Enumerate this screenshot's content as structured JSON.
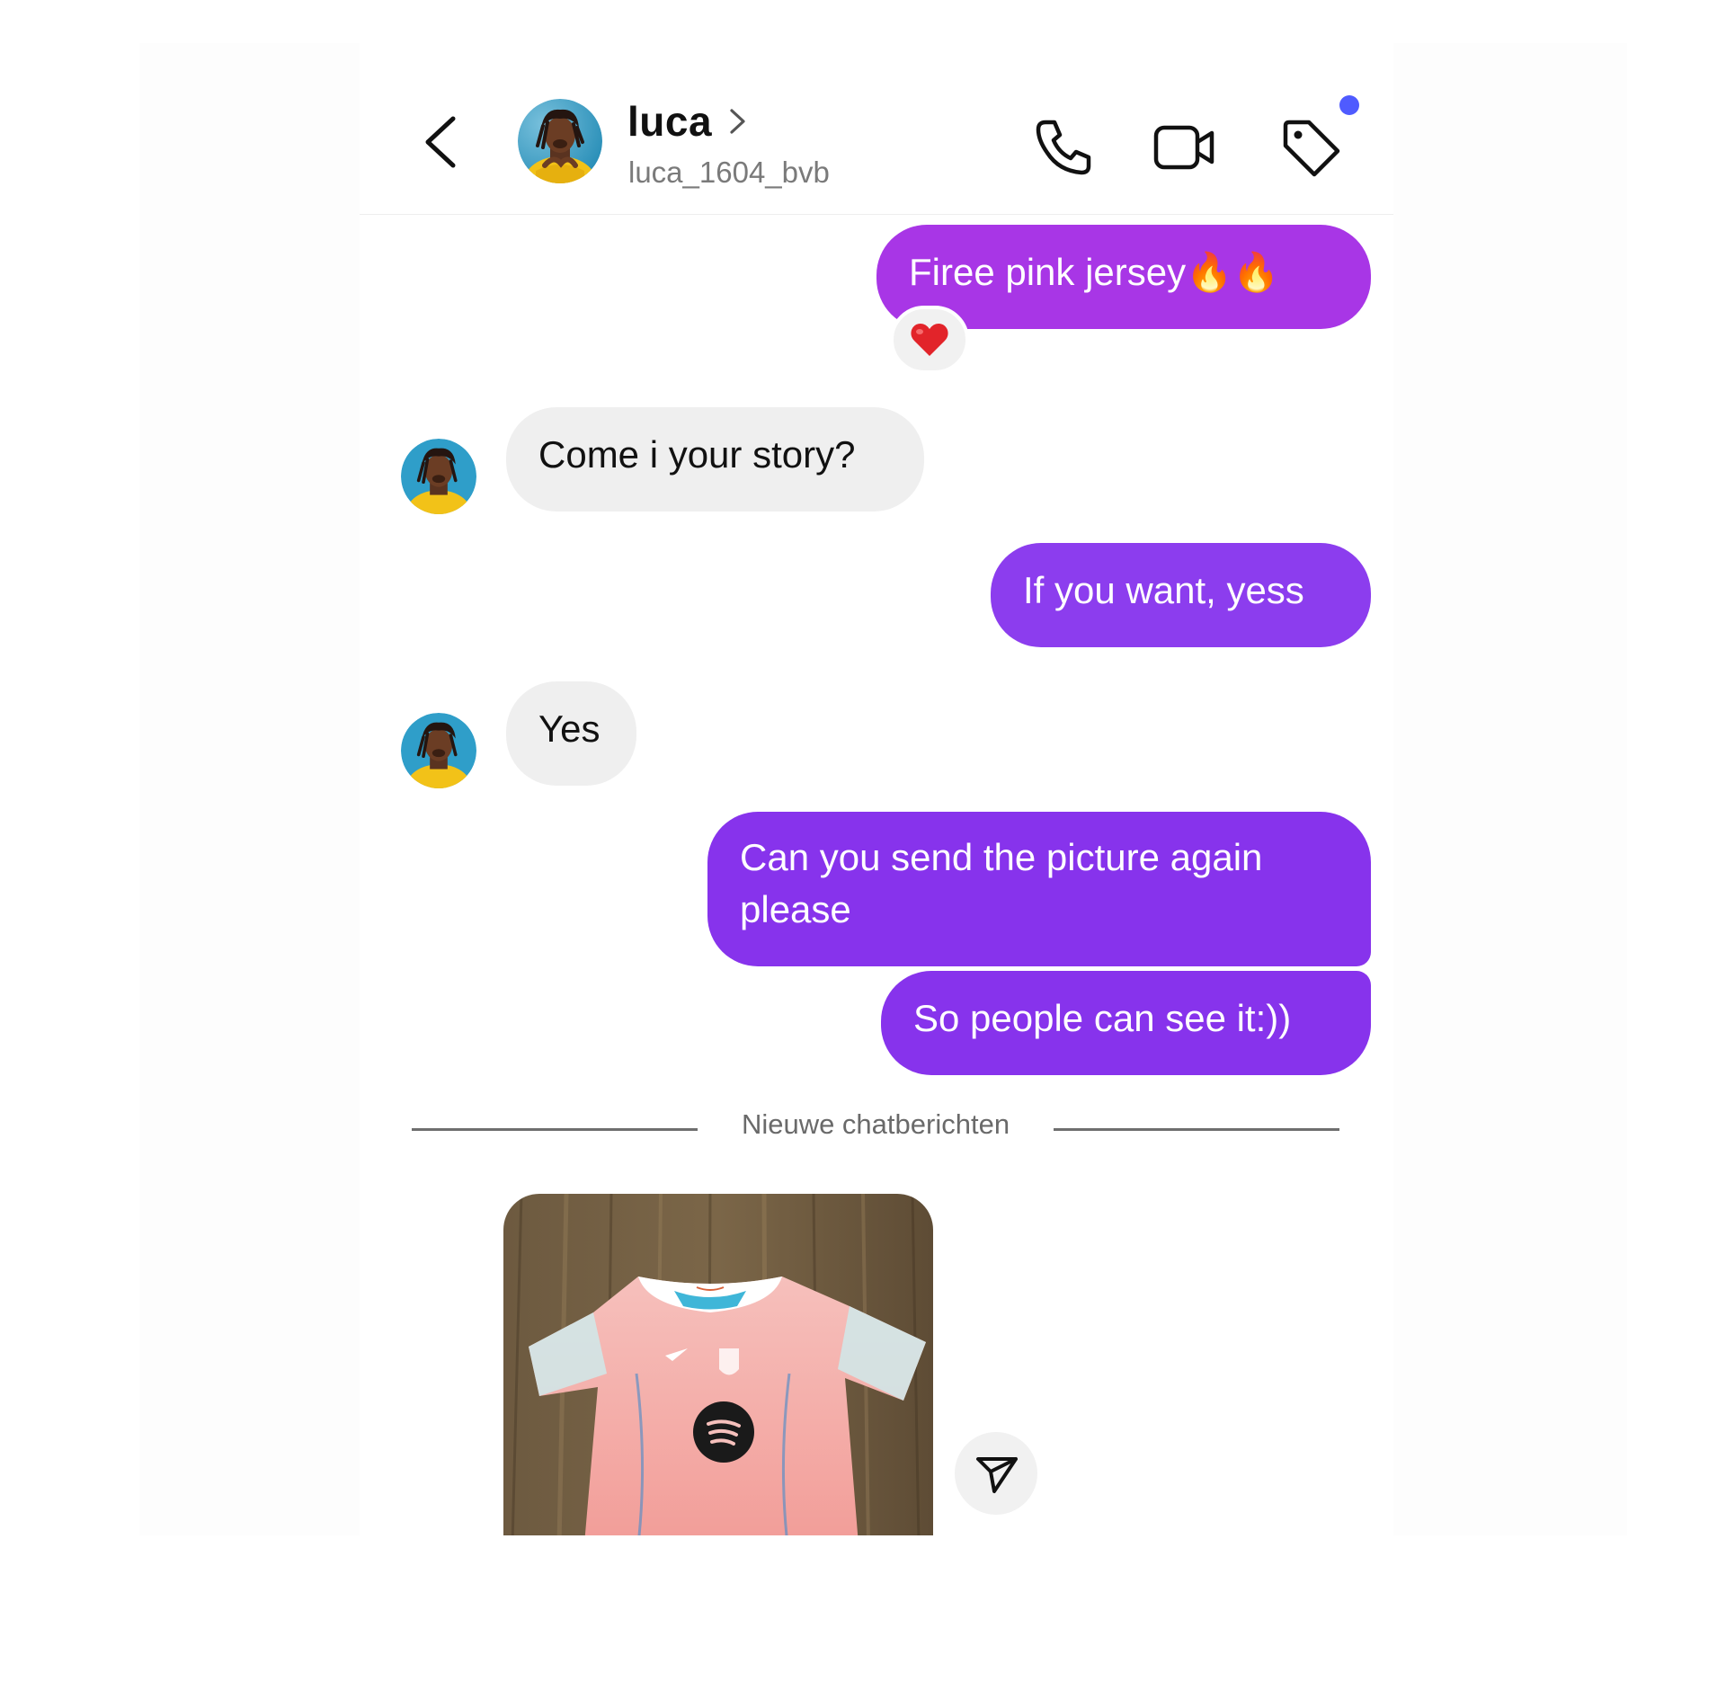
{
  "header": {
    "name": "luca",
    "username": "luca_1604_bvb",
    "notification_dot_color": "#4f5bff",
    "icons": [
      "back-arrow-icon",
      "chevron-right-icon",
      "phone-icon",
      "video-camera-icon",
      "tag-icon"
    ]
  },
  "colors": {
    "sent_bubble": "#8a32ec",
    "received_bubble": "#efefef",
    "reaction": "#e2242a"
  },
  "messages": [
    {
      "sender": "me",
      "text": "Firee pink jersey🔥🔥",
      "reaction": "heart"
    },
    {
      "sender": "luca",
      "text": "Come i your story?"
    },
    {
      "sender": "me",
      "text": "If you want, yess"
    },
    {
      "sender": "luca",
      "text": "Yes"
    },
    {
      "sender": "me",
      "text": "Can you send the picture again please"
    },
    {
      "sender": "me",
      "text": "So people can see it:))"
    }
  ],
  "divider": {
    "label": "Nieuwe chatberichten"
  },
  "photo_message": {
    "sender": "luca",
    "content": "image",
    "share_icon": "send-icon"
  }
}
